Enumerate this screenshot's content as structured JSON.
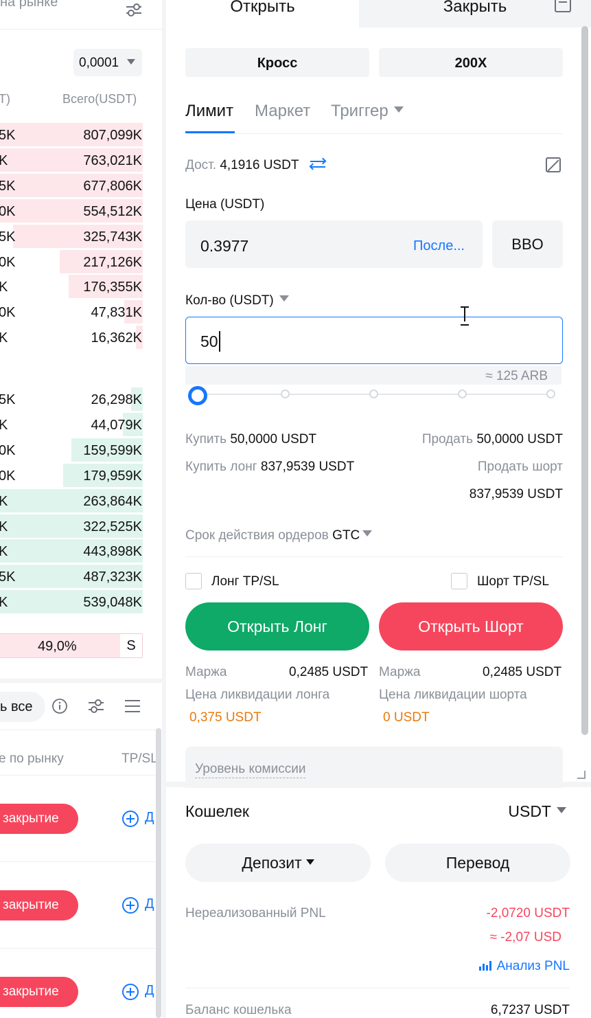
{
  "orderbook": {
    "title_fragment": "на рынке",
    "precision": "0,0001",
    "col_price_fragment": "T)",
    "col_total": "Всего(USDT)",
    "asks": [
      {
        "p": "5K",
        "total": "807,099K",
        "depth": 1.0
      },
      {
        "p": "K",
        "total": "763,021K",
        "depth": 1.0
      },
      {
        "p": "5K",
        "total": "677,806K",
        "depth": 1.0
      },
      {
        "p": "0K",
        "total": "554,512K",
        "depth": 1.0
      },
      {
        "p": "5K",
        "total": "325,743K",
        "depth": 0.91
      },
      {
        "p": "0K",
        "total": "217,126K",
        "depth": 0.58
      },
      {
        "p": "K",
        "total": "176,355K",
        "depth": 0.52
      },
      {
        "p": "0K",
        "total": "47,831K",
        "depth": 0.13
      },
      {
        "p": "K",
        "total": "16,362K",
        "depth": 0.05
      }
    ],
    "bids": [
      {
        "p": "5K",
        "total": "26,298K",
        "depth": 0.08
      },
      {
        "p": "K",
        "total": "44,079K",
        "depth": 0.14
      },
      {
        "p": "0K",
        "total": "159,599K",
        "depth": 0.5
      },
      {
        "p": "0K",
        "total": "179,959K",
        "depth": 0.56
      },
      {
        "p": "K",
        "total": "263,864K",
        "depth": 1.0
      },
      {
        "p": "K",
        "total": "322,525K",
        "depth": 1.0
      },
      {
        "p": "K",
        "total": "443,898K",
        "depth": 1.0
      },
      {
        "p": "5K",
        "total": "487,323K",
        "depth": 1.0
      },
      {
        "p": "K",
        "total": "539,048K",
        "depth": 1.0
      }
    ],
    "ratio_pct": "49,0%",
    "ratio_side": "S"
  },
  "positions": {
    "close_all_fragment": "ь все",
    "col_market_fragment": "е по рынку",
    "col_tpsl": "TP/SL",
    "rows": [
      {
        "close": "закрытие",
        "add": "Д"
      },
      {
        "close": "закрытие",
        "add": "Д"
      },
      {
        "close": "закрытие",
        "add": "Д"
      }
    ]
  },
  "trade": {
    "tab_open": "Открыть",
    "tab_close": "Закрыть",
    "margin_mode": "Кросс",
    "leverage": "200X",
    "order_tabs": [
      {
        "label": "Лимит"
      },
      {
        "label": "Маркет"
      },
      {
        "label": "Триггер"
      }
    ],
    "avail_label": "Дост.",
    "avail_value": "4,1916 USDT",
    "price_label": "Цена (USDT)",
    "price_value": "0.3977",
    "price_last": "После...",
    "bbo": "BBO",
    "qty_label": "Кол-во (USDT)",
    "qty_value": "50",
    "qty_approx": "≈ 125 ARB",
    "slider_percent": 0,
    "buy_label": "Купить",
    "buy_value": "50,0000 USDT",
    "sell_label": "Продать",
    "sell_value": "50,0000 USDT",
    "buy_long_label": "Купить лонг",
    "buy_long_value": "837,9539 USDT",
    "sell_short_label": "Продать шорт",
    "sell_short_value": "837,9539 USDT",
    "tif_label": "Срок действия ордеров",
    "tif_value": "GTC",
    "long_tpsl": "Лонг TP/SL",
    "short_tpsl": "Шорт TP/SL",
    "open_long": "Открыть Лонг",
    "open_short": "Открыть Шорт",
    "margin_label": "Маржа",
    "margin_long": "0,2485 USDT",
    "margin_short": "0,2485 USDT",
    "liq_long_label": "Цена ликвидации лонга",
    "liq_long_value": "0,375 USDT",
    "liq_short_label": "Цена ликвидации шорта",
    "liq_short_value": "0 USDT",
    "fee_level": "Уровень комиссии"
  },
  "wallet": {
    "title": "Кошелек",
    "currency": "USDT",
    "deposit": "Депозит",
    "transfer": "Перевод",
    "upnl_label": "Нереализованный PNL",
    "upnl_value": "-2,0720 USDT",
    "upnl_usd": "≈ -2,07 USD",
    "pnl_analysis": "Анализ PNL",
    "balance_label": "Баланс кошелька",
    "balance_value": "6,7237 USDT"
  },
  "colors": {
    "accent": "#1677ff",
    "buy": "#0fa968",
    "sell": "#f6465d",
    "warning": "#e87a0c",
    "ask_depth": "#fde7ea",
    "bid_depth": "#dff4ec"
  }
}
